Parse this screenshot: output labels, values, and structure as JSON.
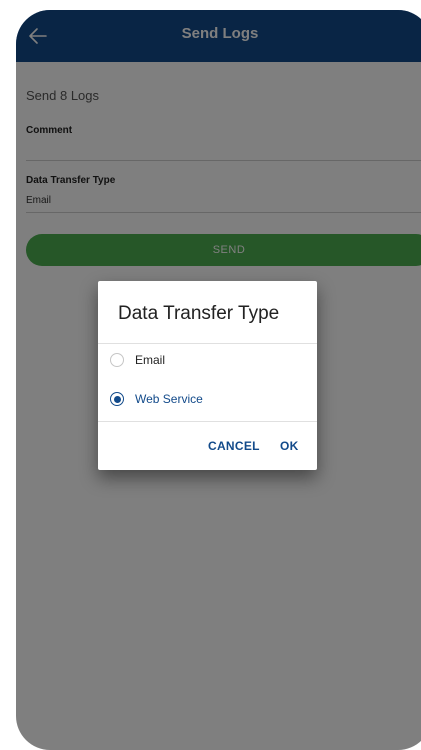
{
  "appbar": {
    "title": "Send Logs",
    "back_icon": "arrow-left-icon"
  },
  "form": {
    "send_count": "Send 8 Logs",
    "comment_label": "Comment",
    "comment_value": "",
    "transfer_label": "Data Transfer Type",
    "transfer_value": "Email",
    "send_button": "SEND"
  },
  "dialog": {
    "title": "Data Transfer Type",
    "options": [
      {
        "label": "Email",
        "selected": false
      },
      {
        "label": "Web Service",
        "selected": true
      }
    ],
    "cancel_label": "CANCEL",
    "ok_label": "OK"
  },
  "colors": {
    "appbar": "#124a8a",
    "send_button": "#4caf50",
    "accent": "#124a8a"
  }
}
